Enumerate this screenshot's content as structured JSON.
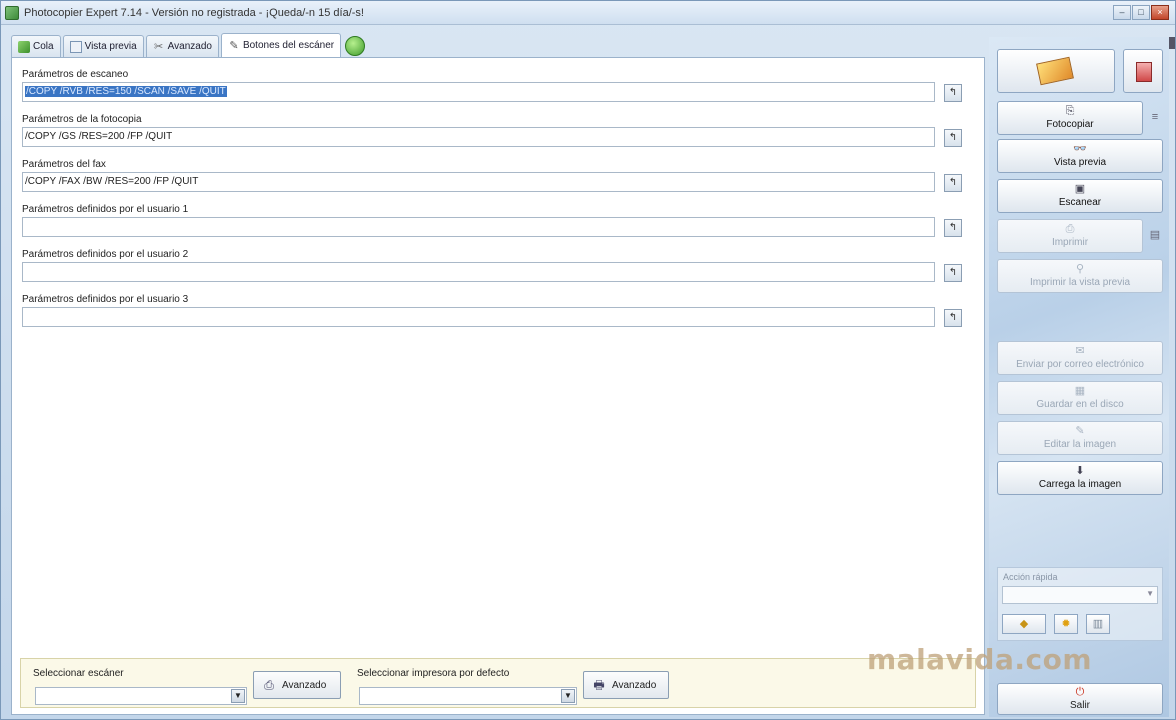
{
  "window": {
    "title": "Photocopier Expert 7.14 - Versión no registrada - ¡Queda/-n 15 día/-s!",
    "buttons": [
      "minimize",
      "maximize",
      "close"
    ]
  },
  "tabs": [
    {
      "label": "Cola",
      "icon": "queue-icon"
    },
    {
      "label": "Vista previa",
      "icon": "preview-icon"
    },
    {
      "label": "Avanzado",
      "icon": "tools-icon"
    },
    {
      "label": "Botones del escáner",
      "icon": "pen-icon",
      "active": true
    }
  ],
  "params": [
    {
      "label": "Parámetros de escaneo",
      "value": "/COPY /RVB /RES=150 /SCAN /SAVE /QUIT",
      "selected": true
    },
    {
      "label": "Parámetros de la fotocopia",
      "value": "/COPY /GS /RES=200 /FP /QUIT"
    },
    {
      "label": "Parámetros del fax",
      "value": "/COPY /FAX /BW /RES=200 /FP /QUIT"
    },
    {
      "label": "Parámetros definidos por el usuario 1",
      "value": ""
    },
    {
      "label": "Parámetros definidos por el usuario 2",
      "value": ""
    },
    {
      "label": "Parámetros definidos por el usuario 3",
      "value": ""
    }
  ],
  "bottom": {
    "scanner_label": "Seleccionar escáner",
    "scanner_value": "",
    "scanner_advanced": "Avanzado",
    "printer_label": "Seleccionar impresora por defecto",
    "printer_value": "",
    "printer_advanced": "Avanzado"
  },
  "sidebar": {
    "buttons": [
      {
        "label": "Fotocopiar",
        "enabled": true,
        "icon": "photocopy-icon"
      },
      {
        "label": "Vista previa",
        "enabled": true,
        "icon": "preview-icon"
      },
      {
        "label": "Escanear",
        "enabled": true,
        "icon": "scan-icon"
      },
      {
        "label": "Imprimir",
        "enabled": false,
        "icon": "print-icon"
      },
      {
        "label": "Imprimir la vista previa",
        "enabled": false,
        "icon": "print-preview-icon"
      },
      {
        "label": "Enviar por correo electrónico",
        "enabled": false,
        "icon": "email-icon"
      },
      {
        "label": "Guardar en el disco",
        "enabled": false,
        "icon": "save-icon"
      },
      {
        "label": "Editar la imagen",
        "enabled": false,
        "icon": "edit-icon"
      },
      {
        "label": "Carrega la imagen",
        "enabled": true,
        "icon": "load-image-icon"
      }
    ],
    "quick_action_label": "Acción rápida",
    "quick_action_value": "",
    "exit_label": "Salir"
  },
  "watermark": "malavida.com"
}
